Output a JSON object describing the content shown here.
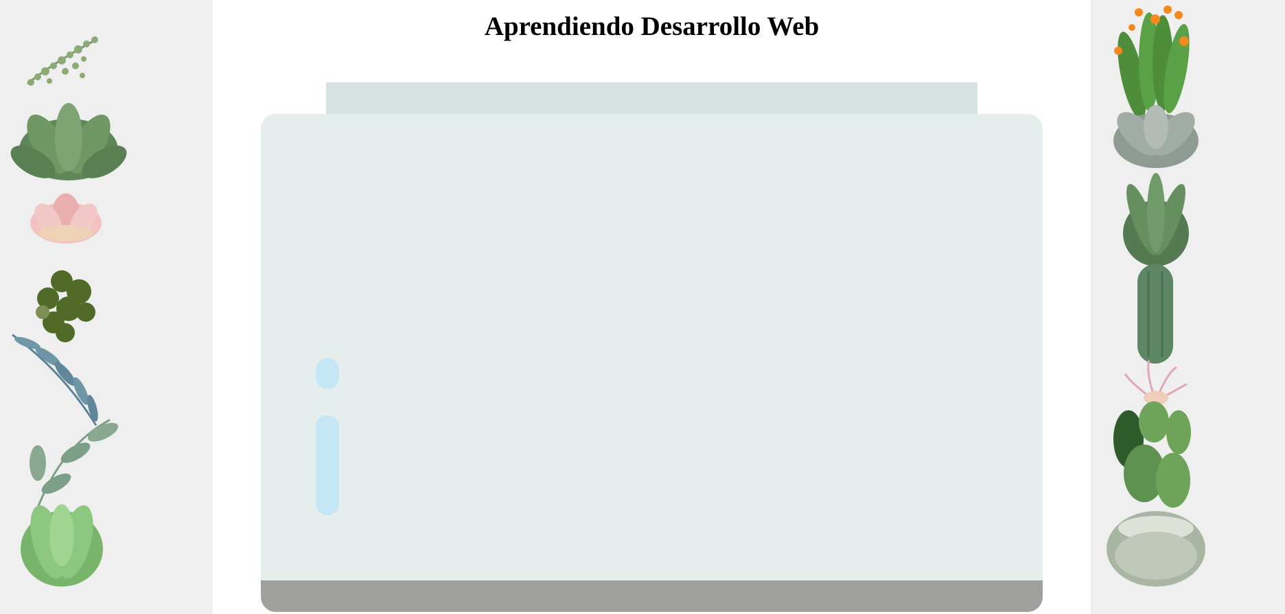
{
  "header": {
    "title": "Aprendiendo Desarrollo Web"
  },
  "colors": {
    "side_background": "#efefef",
    "lid": "#d6e3e2",
    "jar": "#e6eeed",
    "jar_base": "#a0a19c",
    "shine": "#c5e6f4"
  },
  "decorations": {
    "left_column": [
      "trailing-succulent-icon",
      "echeveria-icon",
      "pink-succulent-icon",
      "dark-clover-icon",
      "eucalyptus-branch-icon",
      "green-rosette-icon"
    ],
    "right_column": [
      "flowering-cactus-icon",
      "gray-succulent-icon",
      "aloe-icon",
      "columnar-cactus-icon",
      "air-plant-icon",
      "prickly-pear-icon",
      "round-cactus-icon"
    ]
  }
}
